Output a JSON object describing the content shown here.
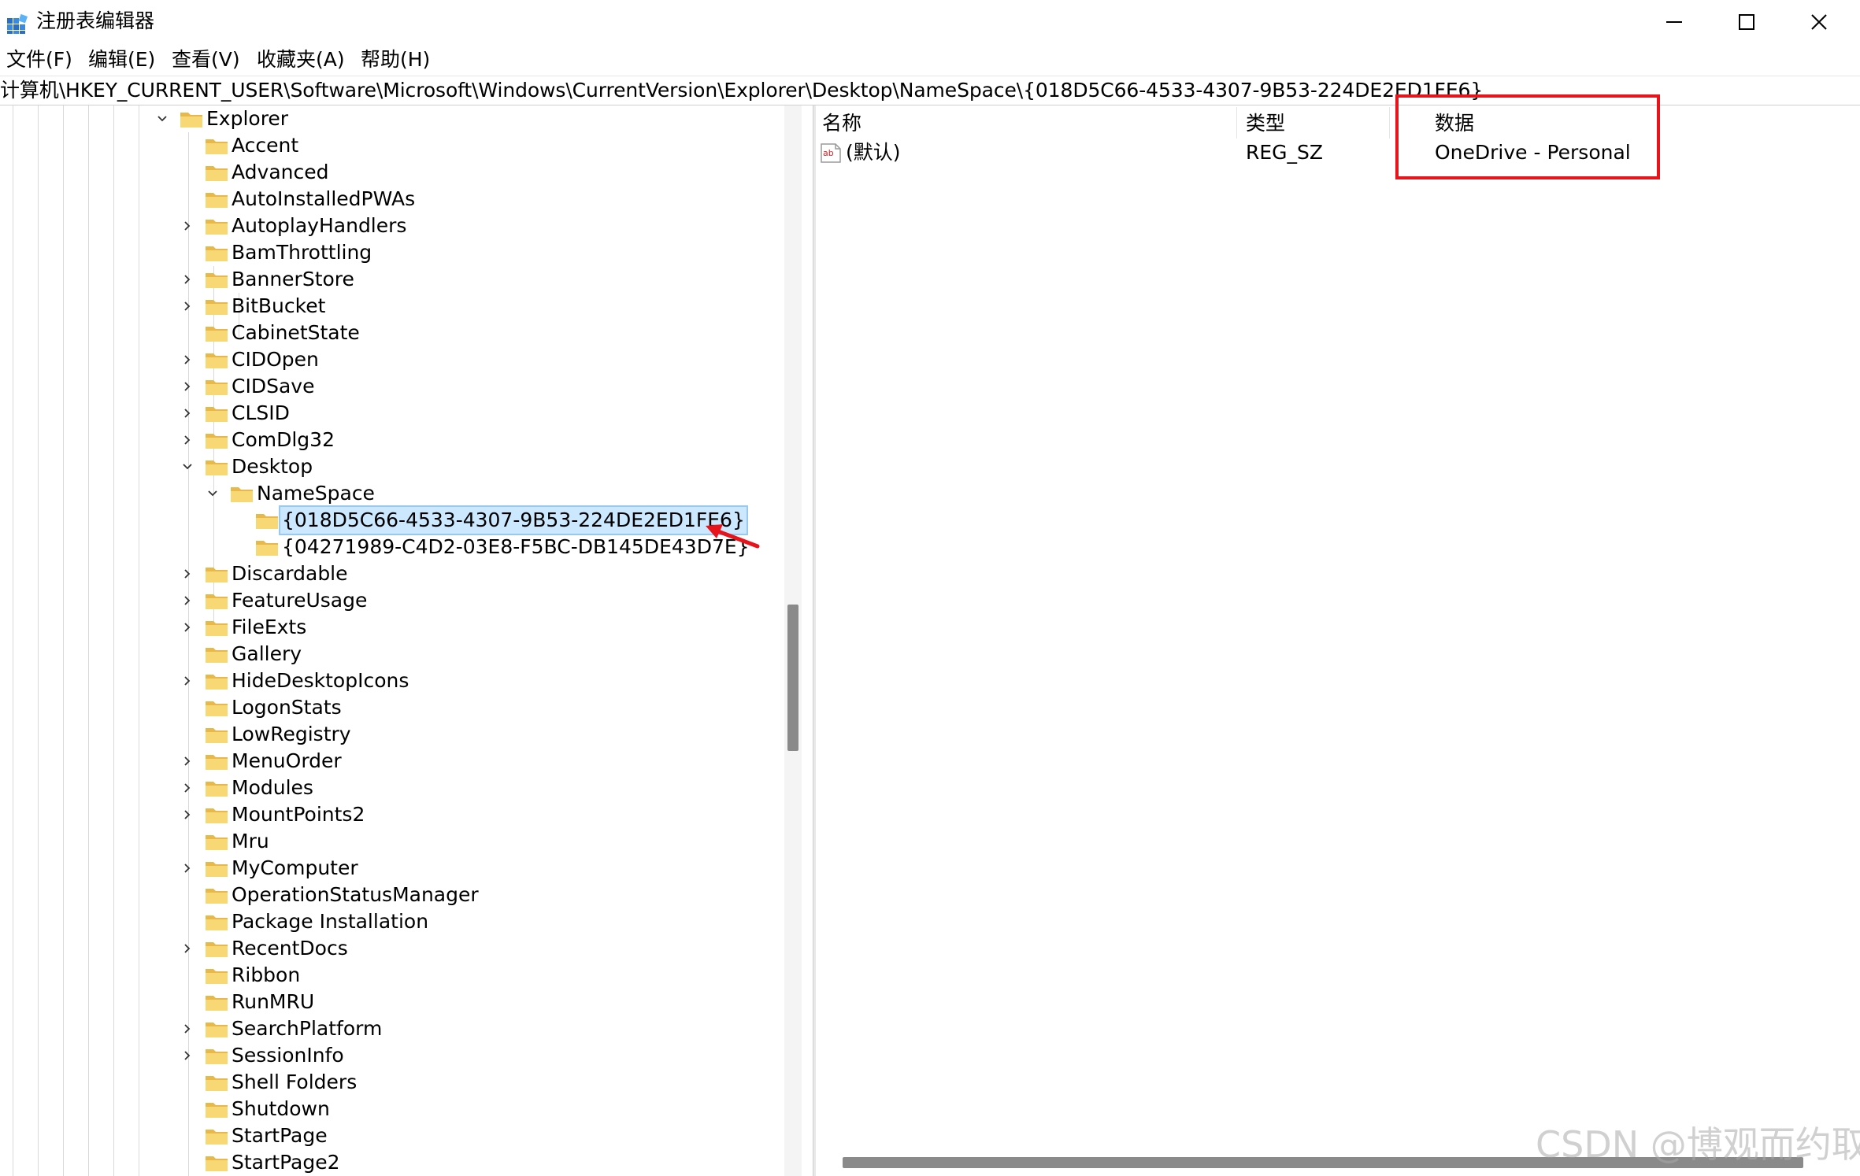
{
  "window": {
    "title": "注册表编辑器",
    "icon": "registry-editor-icon"
  },
  "menu": [
    {
      "label": "文件(F)"
    },
    {
      "label": "编辑(E)"
    },
    {
      "label": "查看(V)"
    },
    {
      "label": "收藏夹(A)"
    },
    {
      "label": "帮助(H)"
    }
  ],
  "address": "计算机\\HKEY_CURRENT_USER\\Software\\Microsoft\\Windows\\CurrentVersion\\Explorer\\Desktop\\NameSpace\\{018D5C66-4533-4307-9B53-224DE2ED1FE6}",
  "tree": [
    {
      "label": "Explorer",
      "level": 0,
      "expander": "expanded"
    },
    {
      "label": "Accent",
      "level": 1,
      "expander": "none"
    },
    {
      "label": "Advanced",
      "level": 1,
      "expander": "none"
    },
    {
      "label": "AutoInstalledPWAs",
      "level": 1,
      "expander": "none"
    },
    {
      "label": "AutoplayHandlers",
      "level": 1,
      "expander": "collapsed"
    },
    {
      "label": "BamThrottling",
      "level": 1,
      "expander": "none"
    },
    {
      "label": "BannerStore",
      "level": 1,
      "expander": "collapsed"
    },
    {
      "label": "BitBucket",
      "level": 1,
      "expander": "collapsed"
    },
    {
      "label": "CabinetState",
      "level": 1,
      "expander": "none"
    },
    {
      "label": "CIDOpen",
      "level": 1,
      "expander": "collapsed"
    },
    {
      "label": "CIDSave",
      "level": 1,
      "expander": "collapsed"
    },
    {
      "label": "CLSID",
      "level": 1,
      "expander": "collapsed"
    },
    {
      "label": "ComDlg32",
      "level": 1,
      "expander": "collapsed"
    },
    {
      "label": "Desktop",
      "level": 1,
      "expander": "expanded"
    },
    {
      "label": "NameSpace",
      "level": 2,
      "expander": "expanded"
    },
    {
      "label": "{018D5C66-4533-4307-9B53-224DE2ED1FE6}",
      "level": 3,
      "expander": "none",
      "selected": true
    },
    {
      "label": "{04271989-C4D2-03E8-F5BC-DB145DE43D7E}",
      "level": 3,
      "expander": "none"
    },
    {
      "label": "Discardable",
      "level": 1,
      "expander": "collapsed"
    },
    {
      "label": "FeatureUsage",
      "level": 1,
      "expander": "collapsed"
    },
    {
      "label": "FileExts",
      "level": 1,
      "expander": "collapsed"
    },
    {
      "label": "Gallery",
      "level": 1,
      "expander": "none"
    },
    {
      "label": "HideDesktopIcons",
      "level": 1,
      "expander": "collapsed"
    },
    {
      "label": "LogonStats",
      "level": 1,
      "expander": "none"
    },
    {
      "label": "LowRegistry",
      "level": 1,
      "expander": "none"
    },
    {
      "label": "MenuOrder",
      "level": 1,
      "expander": "collapsed"
    },
    {
      "label": "Modules",
      "level": 1,
      "expander": "collapsed"
    },
    {
      "label": "MountPoints2",
      "level": 1,
      "expander": "collapsed"
    },
    {
      "label": "Mru",
      "level": 1,
      "expander": "none"
    },
    {
      "label": "MyComputer",
      "level": 1,
      "expander": "collapsed"
    },
    {
      "label": "OperationStatusManager",
      "level": 1,
      "expander": "none"
    },
    {
      "label": "Package Installation",
      "level": 1,
      "expander": "none"
    },
    {
      "label": "RecentDocs",
      "level": 1,
      "expander": "collapsed"
    },
    {
      "label": "Ribbon",
      "level": 1,
      "expander": "none"
    },
    {
      "label": "RunMRU",
      "level": 1,
      "expander": "none"
    },
    {
      "label": "SearchPlatform",
      "level": 1,
      "expander": "collapsed"
    },
    {
      "label": "SessionInfo",
      "level": 1,
      "expander": "collapsed"
    },
    {
      "label": "Shell Folders",
      "level": 1,
      "expander": "none"
    },
    {
      "label": "Shutdown",
      "level": 1,
      "expander": "none"
    },
    {
      "label": "StartPage",
      "level": 1,
      "expander": "none"
    },
    {
      "label": "StartPage2",
      "level": 1,
      "expander": "none"
    }
  ],
  "values": {
    "headers": {
      "name": "名称",
      "type": "类型",
      "data": "数据"
    },
    "rows": [
      {
        "icon": "string-value-icon",
        "name": "(默认)",
        "type": "REG_SZ",
        "data": "OneDrive - Personal"
      }
    ]
  },
  "colors": {
    "highlight_box": "#e8141c",
    "annotation_arrow": "#e8141c",
    "selection": "#cce8ff",
    "folder": "#f8d775"
  },
  "watermark": "CSDN @博观而约取"
}
